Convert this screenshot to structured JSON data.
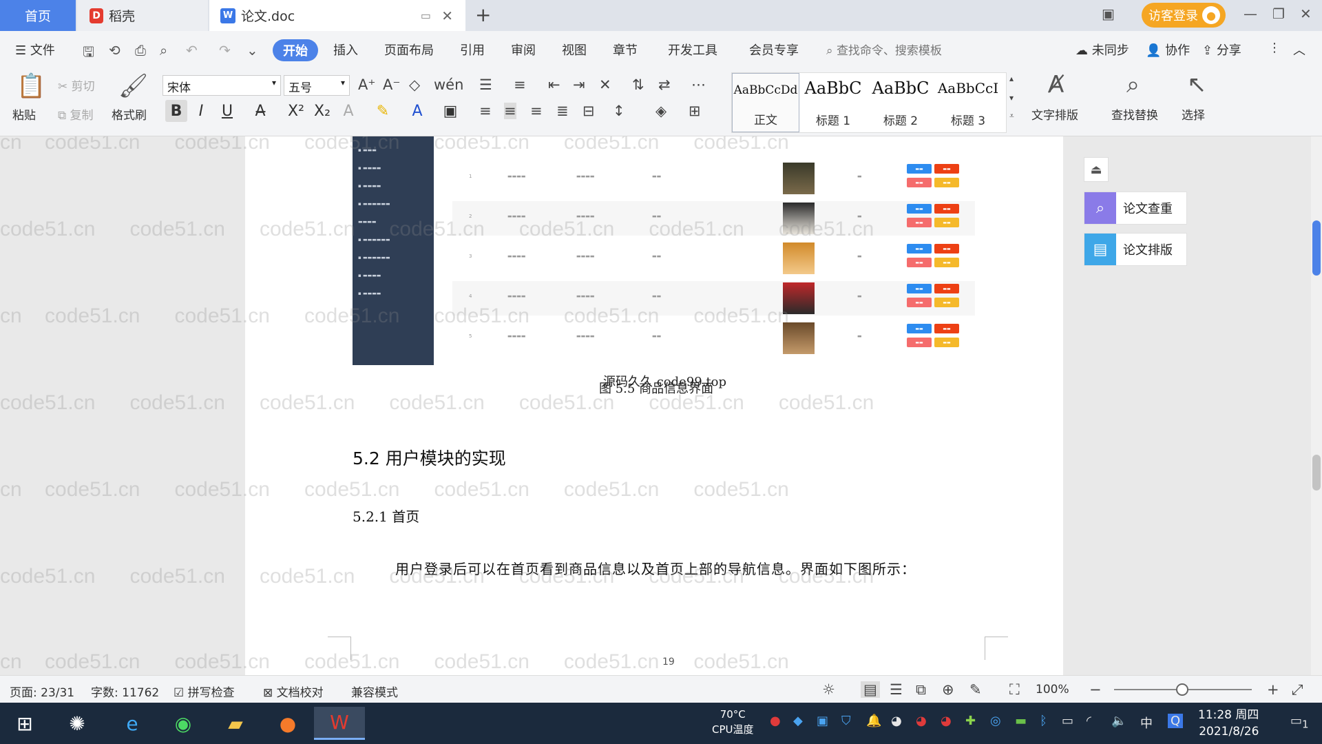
{
  "tabs": {
    "home": "首页",
    "daoke": "稻壳",
    "doc": "论文.doc",
    "login": "访客登录"
  },
  "menu": {
    "file": "文件",
    "start": "开始",
    "items": [
      "插入",
      "页面布局",
      "引用",
      "审阅",
      "视图",
      "章节",
      "开发工具",
      "会员专享"
    ],
    "search": "查找命令、搜索模板",
    "sync": "未同步",
    "collab": "协作",
    "share": "分享"
  },
  "ribbon": {
    "paste": "粘贴",
    "cut": "剪切",
    "copy": "复制",
    "format_painter": "格式刷",
    "font": "宋体",
    "size": "五号",
    "styles": [
      {
        "sample": "AaBbCcDd",
        "name": "正文"
      },
      {
        "sample": "AaBbC",
        "name": "标题 1"
      },
      {
        "sample": "AaBbC",
        "name": "标题 2"
      },
      {
        "sample": "AaBbCcI",
        "name": "标题 3"
      }
    ],
    "text_layout": "文字排版",
    "find_replace": "查找替换",
    "select": "选择"
  },
  "document": {
    "figure_rows": [
      "1",
      "2",
      "3",
      "4",
      "5"
    ],
    "caption_overlay": "源码久久 code99.top",
    "caption": "图 5.5 商品信息界面",
    "heading2": "5.2  用户模块的实现",
    "heading3": "5.2.1  首页",
    "paragraph": "用户登录后可以在首页看到商品信息以及首页上部的导航信息。界面如下图所示：",
    "page_number": "19",
    "watermark": "code51.cn"
  },
  "side_panel": {
    "check": "论文查重",
    "layout": "论文排版"
  },
  "status": {
    "page": "页面: 23/31",
    "words": "字数: 11762",
    "spell": "拼写检查",
    "proof": "文档校对",
    "compat": "兼容模式",
    "zoom": "100%"
  },
  "taskbar": {
    "cpu_temp": "70°C",
    "cpu_label": "CPU温度",
    "ime": "中",
    "time": "11:28 周四",
    "date": "2021/8/26",
    "notif": "1"
  }
}
